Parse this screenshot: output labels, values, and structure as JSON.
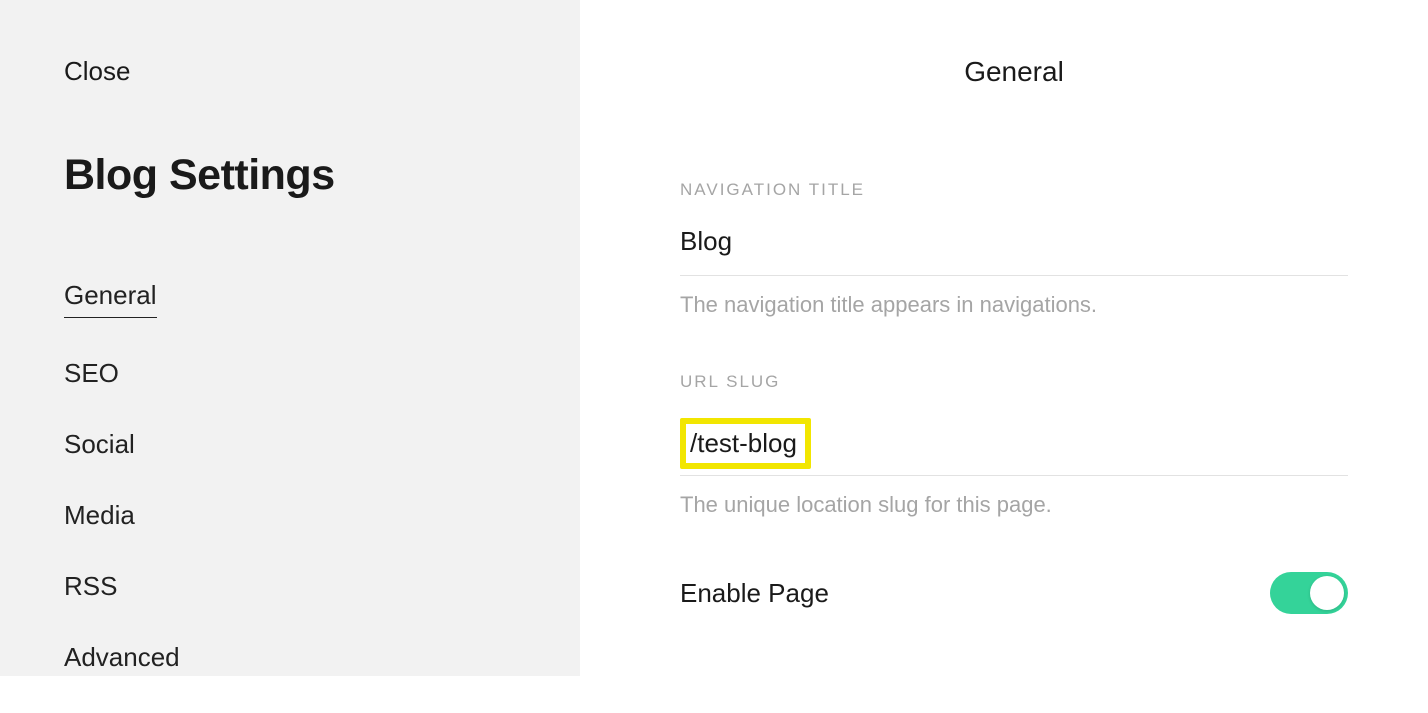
{
  "sidebar": {
    "close": "Close",
    "title": "Blog Settings",
    "items": [
      {
        "label": "General",
        "active": true
      },
      {
        "label": "SEO",
        "active": false
      },
      {
        "label": "Social",
        "active": false
      },
      {
        "label": "Media",
        "active": false
      },
      {
        "label": "RSS",
        "active": false
      },
      {
        "label": "Advanced",
        "active": false
      }
    ]
  },
  "main": {
    "header": "General",
    "nav_title": {
      "label": "NAVIGATION TITLE",
      "value": "Blog",
      "help": "The navigation title appears in navigations."
    },
    "url_slug": {
      "label": "URL SLUG",
      "value": "/test-blog",
      "help": "The unique location slug for this page."
    },
    "enable_page": {
      "label": "Enable Page",
      "enabled": true
    }
  }
}
